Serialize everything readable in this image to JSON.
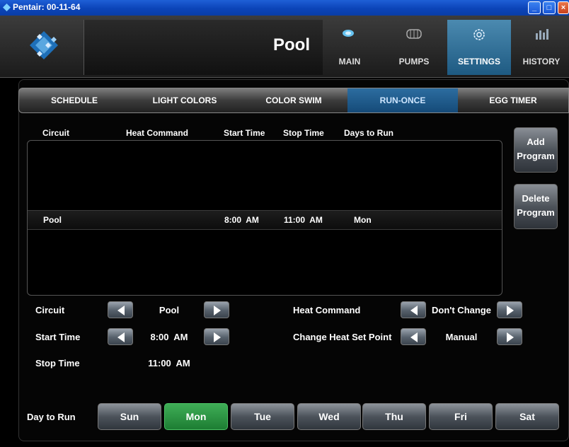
{
  "window": {
    "title": "Pentair: 00-11-64"
  },
  "header": {
    "title": "Pool",
    "nav": [
      {
        "label": "MAIN",
        "icon": "pool-icon"
      },
      {
        "label": "PUMPS",
        "icon": "pump-icon"
      },
      {
        "label": "SETTINGS",
        "icon": "gear-icon",
        "active": true
      },
      {
        "label": "HISTORY",
        "icon": "bar-chart-icon"
      }
    ]
  },
  "tabs": [
    {
      "label": "SCHEDULE"
    },
    {
      "label": "LIGHT COLORS"
    },
    {
      "label": "COLOR SWIM"
    },
    {
      "label": "RUN-ONCE",
      "active": true
    },
    {
      "label": "EGG TIMER"
    }
  ],
  "table": {
    "columns": [
      "Circuit",
      "Heat Command",
      "Start Time",
      "Stop Time",
      "Days to Run"
    ],
    "rows": [
      {
        "circuit": "Pool",
        "heat_command": "",
        "start_time": "8:00  AM",
        "stop_time": "11:00  AM",
        "days": "Mon"
      }
    ]
  },
  "buttons": {
    "add_program": [
      "Add",
      "Program"
    ],
    "delete_program": [
      "Delete",
      "Program"
    ]
  },
  "form": {
    "circuit_label": "Circuit",
    "circuit_value": "Pool",
    "start_time_label": "Start Time",
    "start_time_value": "8:00  AM",
    "stop_time_label": "Stop Time",
    "stop_time_value": "11:00  AM",
    "heat_command_label": "Heat Command",
    "heat_command_value": "Don't Change",
    "heat_setpoint_label": "Change Heat Set Point",
    "heat_setpoint_value": "Manual"
  },
  "days": {
    "label": "Day to Run",
    "items": [
      {
        "label": "Sun"
      },
      {
        "label": "Mon",
        "active": true
      },
      {
        "label": "Tue"
      },
      {
        "label": "Wed"
      },
      {
        "label": "Thu"
      },
      {
        "label": "Fri"
      },
      {
        "label": "Sat"
      }
    ]
  },
  "colors": {
    "accent": "#1e5a82",
    "active_day": "#2a9a44",
    "titlebar": "#0b44b8"
  }
}
